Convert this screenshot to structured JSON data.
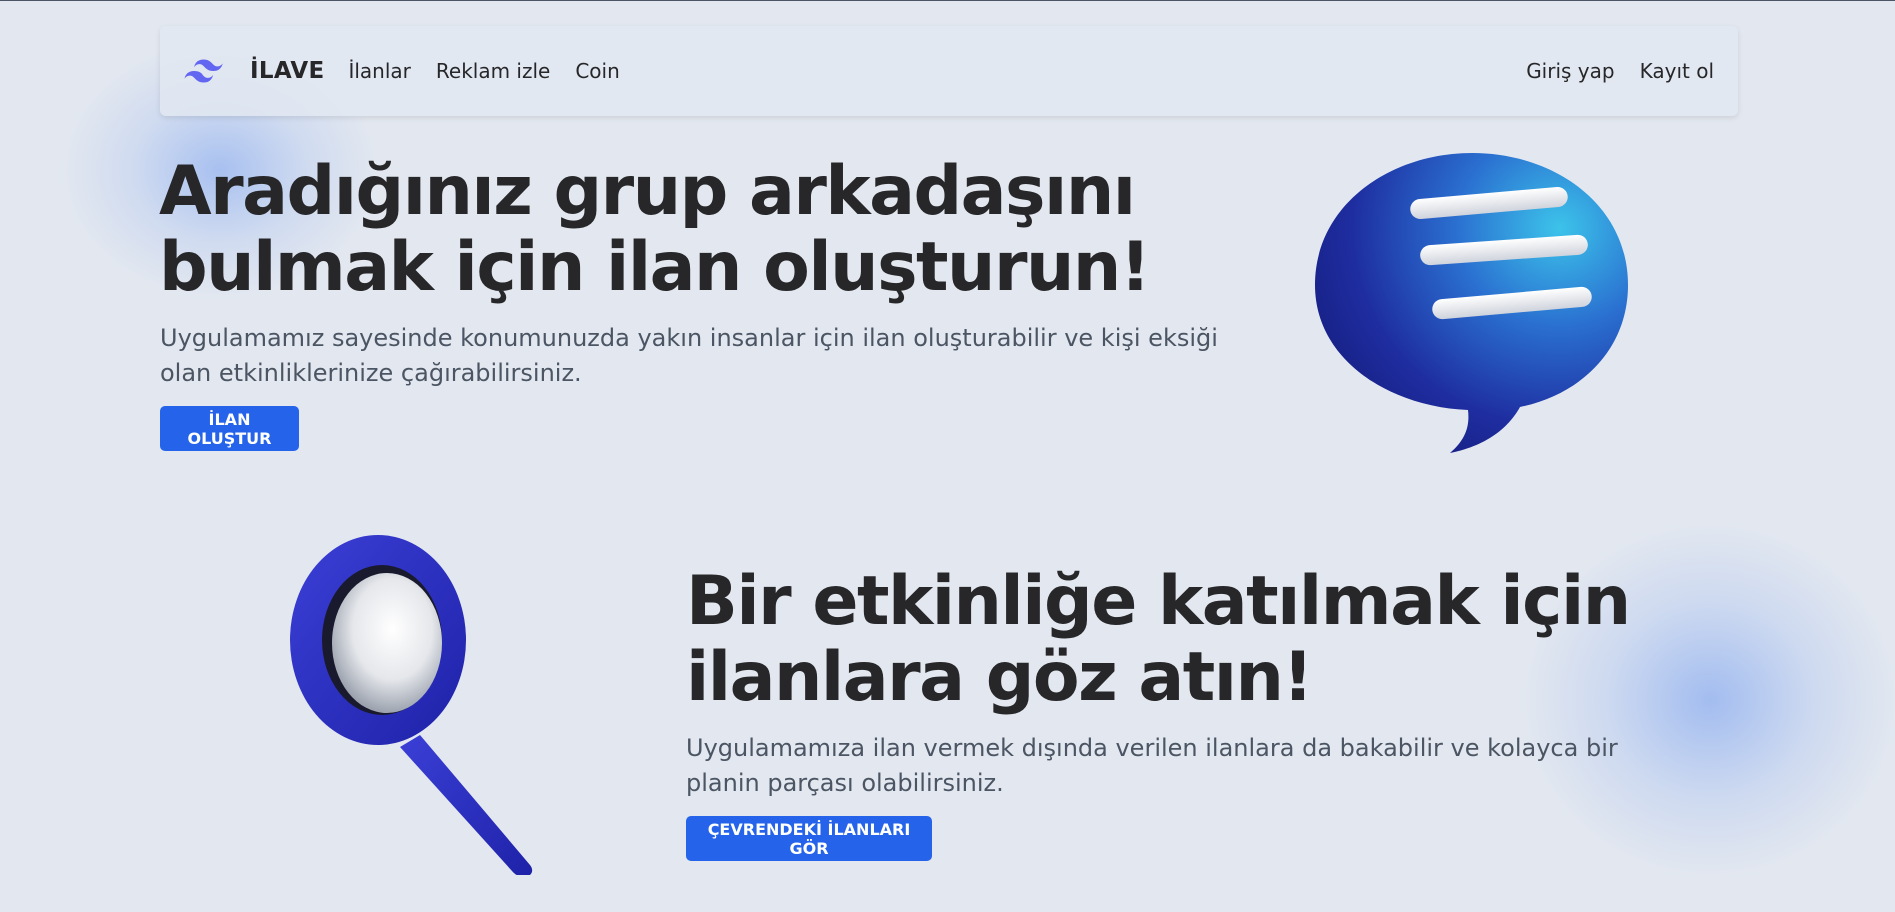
{
  "nav": {
    "brand": "İLAVE",
    "links": [
      "İlanlar",
      "Reklam izle",
      "Coin"
    ],
    "auth": {
      "login": "Giriş yap",
      "register": "Kayıt ol"
    }
  },
  "hero_create": {
    "title_line1": "Aradığınız grup arkadaşını",
    "title_line2": "bulmak için ilan oluşturun!",
    "subtitle": "Uygulamamız sayesinde konumunuzda yakın insanlar için ilan oluşturabilir ve kişi eksiği olan etkinliklerinize çağırabilirsiniz.",
    "button": "İLAN OLUŞTUR",
    "image_icon": "chat-bubble-icon"
  },
  "hero_browse": {
    "title_line1": "Bir etkinliğe katılmak için",
    "title_line2": "ilanlara göz atın!",
    "subtitle": "Uygulamamıza ilan vermek dışında verilen ilanlara da bakabilir ve kolayca bir planin parçası olabilirsiniz.",
    "button": "ÇEVRENDEKİ İLANLARI GÖR",
    "image_icon": "magnifier-icon"
  },
  "colors": {
    "background": "#e3e8f0",
    "primary_button": "#2563eb",
    "heading_text": "#27272a",
    "body_text": "#4b5563",
    "logo": "#6366f1"
  }
}
